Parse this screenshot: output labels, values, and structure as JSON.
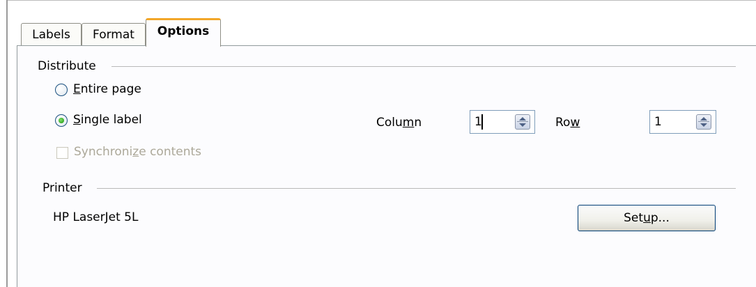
{
  "tabs": [
    {
      "label": "Labels"
    },
    {
      "label": "Format"
    },
    {
      "label": "Options"
    }
  ],
  "distribute": {
    "heading": "Distribute",
    "entire_page": {
      "prefix": "",
      "mnemonic": "E",
      "rest": "ntire page",
      "selected": false
    },
    "single_label": {
      "prefix": "",
      "mnemonic": "S",
      "rest": "ingle label",
      "selected": true
    },
    "synchronize": {
      "pre": "Synchroni",
      "mnemonic": "z",
      "post": "e contents",
      "checked": false,
      "disabled": true
    },
    "column": {
      "pre": "Colu",
      "mnemonic": "m",
      "post": "n",
      "value": "1"
    },
    "row": {
      "pre": "Ro",
      "mnemonic": "w",
      "post": "",
      "value": "1"
    }
  },
  "printer": {
    "heading": "Printer",
    "name": "HP LaserJet 5L",
    "setup": {
      "pre": "Set",
      "mnemonic": "u",
      "post": "p..."
    }
  },
  "colors": {
    "active_tab_accent": "#f2a628",
    "radio_dot": "#2aa01b"
  }
}
